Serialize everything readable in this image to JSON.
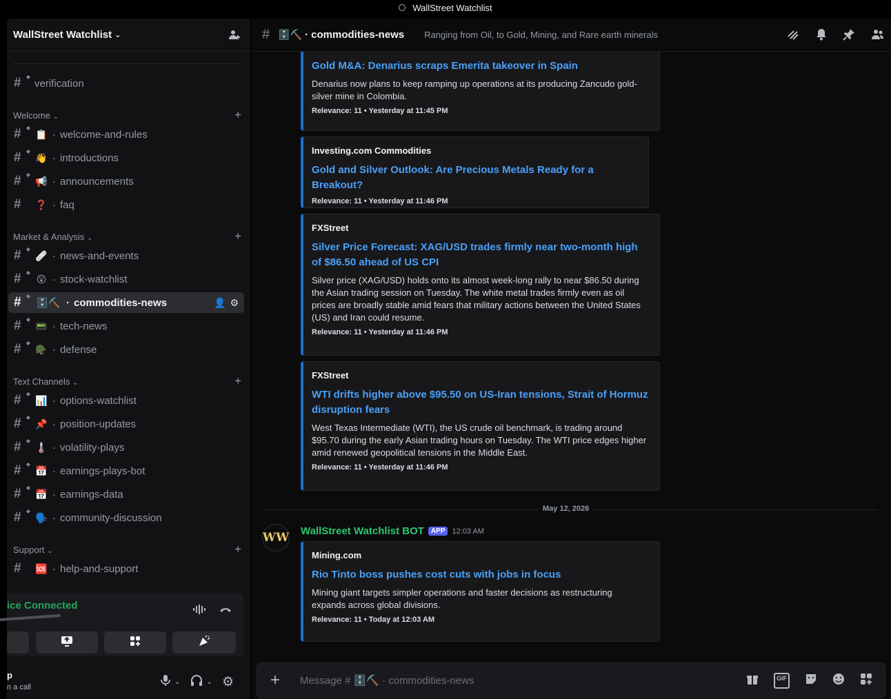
{
  "window": {
    "title": "WallStreet Watchlist"
  },
  "server": {
    "name": "WallStreet Watchlist"
  },
  "sidebar": {
    "top_channels": [
      {
        "name": "verification"
      }
    ],
    "categories": [
      {
        "name": "Welcome",
        "channels": [
          {
            "emoji": "📋",
            "name": "welcome-and-rules"
          },
          {
            "emoji": "👋",
            "name": "introductions"
          },
          {
            "emoji": "📢",
            "name": "announcements"
          },
          {
            "emoji": "❓",
            "name": "faq"
          }
        ]
      },
      {
        "name": "Market & Analysis",
        "channels": [
          {
            "emoji": "🩹",
            "name": "news-and-events"
          },
          {
            "emoji": "😲",
            "name": "stock-watchlist"
          },
          {
            "emoji": "🗄️⛏️",
            "name": "commodities-news"
          },
          {
            "emoji": "📟",
            "name": "tech-news"
          },
          {
            "emoji": "🪖",
            "name": "defense"
          }
        ]
      },
      {
        "name": "Text Channels",
        "channels": [
          {
            "emoji": "📊",
            "name": "options-watchlist"
          },
          {
            "emoji": "📌",
            "name": "position-updates"
          },
          {
            "emoji": "🌡️",
            "name": "volatility-plays"
          },
          {
            "emoji": "📅",
            "name": "earnings-plays-bot"
          },
          {
            "emoji": "📅",
            "name": "earnings-data"
          },
          {
            "emoji": "🗣️",
            "name": "community-discussion"
          }
        ]
      },
      {
        "name": "Support",
        "channels": [
          {
            "emoji": "🆘",
            "name": "help-and-support"
          }
        ]
      }
    ]
  },
  "voice": {
    "status": "ice Connected"
  },
  "user": {
    "name": "p",
    "status": "n a call"
  },
  "channel": {
    "emoji": "🗄️⛏️",
    "name": "commodities-news",
    "topic": "Ranging from Oil, to Gold, Mining, and Rare earth minerals"
  },
  "embeds": [
    {
      "author": "",
      "title": "Gold M&A: Denarius scraps Emerita takeover in Spain",
      "description": "Denarius now plans to keep ramping up operations at its producing Zancudo gold-silver mine in Colombia.",
      "footer": "Relevance: 11 • Yesterday at 11:45 PM"
    },
    {
      "author": "Investing.com Commodities",
      "title": "Gold and Silver Outlook: Are Precious Metals Ready for a Breakout?",
      "description": "",
      "footer": "Relevance: 11 • Yesterday at 11:46 PM"
    },
    {
      "author": "FXStreet",
      "title": "Silver Price Forecast: XAG/USD trades firmly near two-month high of $86.50 ahead of US CPI",
      "description": "Silver price (XAG/USD) holds onto its almost week-long rally to near $86.50 during the Asian trading session on Tuesday. The white metal trades firmly even as oil prices are broadly stable amid fears that military actions between the United States (US) and Iran could resume.",
      "footer": "Relevance: 11 • Yesterday at 11:46 PM"
    },
    {
      "author": "FXStreet",
      "title": "WTI drifts higher above $95.50 on US-Iran tensions, Strait of Hormuz disruption fears",
      "description": "West Texas Intermediate (WTI), the US crude oil benchmark, is trading around $95.70 during the early Asian trading hours on Tuesday. The WTI price edges higher amid renewed geopolitical tensions in the Middle East.",
      "footer": "Relevance: 11 • Yesterday at 11:46 PM"
    },
    {
      "author": "Mining.com",
      "title": "Rio Tinto boss pushes cost cuts with jobs in focus",
      "description": "Mining giant targets simpler operations and faster decisions as restructuring expands across global divisions.",
      "footer": "Relevance: 11 • Today at 12:03 AM"
    }
  ],
  "date_divider": "May 12, 2026",
  "message": {
    "author": "WallStreet Watchlist BOT",
    "badge": "APP",
    "time": "12:03 AM",
    "avatar_text": "WW"
  },
  "composer": {
    "prefix": "Message #",
    "emoji": "🗄️⛏️",
    "channel": "commodities-news",
    "gif_label": "GIF"
  }
}
